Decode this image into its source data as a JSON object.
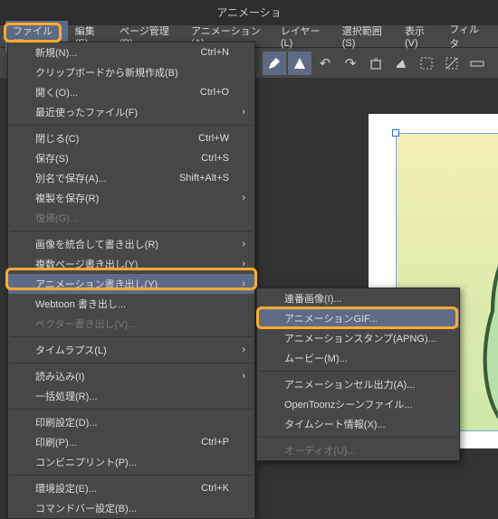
{
  "title": "アニメーショ",
  "menubar": {
    "file": "ファイル(F)",
    "edit": "編集(E)",
    "page": "ページ管理(P)",
    "anim": "アニメーション(A)",
    "layer": "レイヤー(L)",
    "select": "選択範囲(S)",
    "view": "表示(V)",
    "filter": "フィルタ"
  },
  "menu": {
    "new": "新規(N)...",
    "new_sc": "Ctrl+N",
    "clip": "クリップボードから新規作成(B)",
    "open": "開く(O)...",
    "open_sc": "Ctrl+O",
    "recent": "最近使ったファイル(F)",
    "close": "閉じる(C)",
    "close_sc": "Ctrl+W",
    "save": "保存(S)",
    "save_sc": "Ctrl+S",
    "saveas": "別名で保存(A)...",
    "saveas_sc": "Shift+Alt+S",
    "savedup": "複製を保存(R)",
    "revert": "復帰(G)...",
    "flatten": "画像を統合して書き出し(R)",
    "multipage": "複数ページ書き出し(Y)",
    "animexp": "アニメーション書き出し(Y)",
    "webtoon": "Webtoon 書き出し...",
    "vector": "ベクター書き出し(V)...",
    "timelapse": "タイムラプス(L)",
    "import": "読み込み(I)",
    "batch": "一括処理(R)...",
    "printset": "印刷設定(D)...",
    "print": "印刷(P)...",
    "print_sc": "Ctrl+P",
    "conveni": "コンビニプリント(P)...",
    "prefs": "環境設定(E)...",
    "prefs_sc": "Ctrl+K",
    "cmdbar": "コマンドバー設定(B)..."
  },
  "sub": {
    "seq": "連番画像(I)...",
    "gif": "アニメーションGIF...",
    "apng": "アニメーションスタンプ(APNG)...",
    "movie": "ムービー(M)...",
    "cel": "アニメーションセル出力(A)...",
    "open": "OpenToonzシーンファイル...",
    "sheet": "タイムシート情報(X)...",
    "audio": "オーディオ(U)..."
  }
}
